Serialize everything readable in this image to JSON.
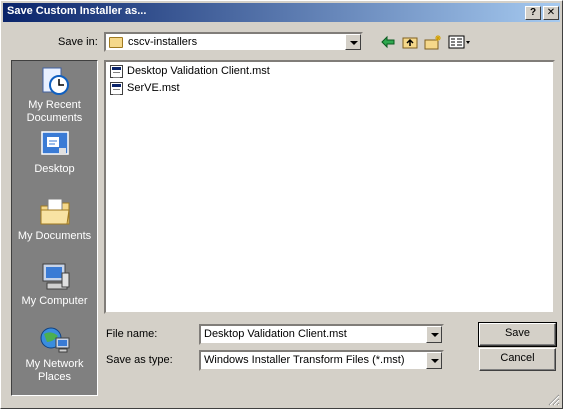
{
  "window": {
    "title": "Save Custom Installer as...",
    "help_glyph": "?",
    "close_glyph": "✕"
  },
  "save_in": {
    "label": "Save in:",
    "folder": "cscv-installers"
  },
  "toolbar": {
    "icons": [
      "back-icon",
      "up-folder-icon",
      "new-folder-icon",
      "views-menu-icon"
    ]
  },
  "places": [
    {
      "label": "My Recent Documents",
      "icon": "recent-documents-icon"
    },
    {
      "label": "Desktop",
      "icon": "desktop-icon"
    },
    {
      "label": "My Documents",
      "icon": "my-documents-icon"
    },
    {
      "label": "My Computer",
      "icon": "my-computer-icon"
    },
    {
      "label": "My Network Places",
      "icon": "network-places-icon"
    }
  ],
  "files": [
    {
      "name": "Desktop Validation Client.mst"
    },
    {
      "name": "SerVE.mst"
    }
  ],
  "file_name": {
    "label": "File name:",
    "value": "Desktop Validation Client.mst"
  },
  "save_as_type": {
    "label": "Save as type:",
    "value": "Windows Installer Transform Files (*.mst)"
  },
  "buttons": {
    "save": "Save",
    "cancel": "Cancel"
  },
  "colors": {
    "title_gradient_start": "#0a246a",
    "title_gradient_end": "#a6caf0",
    "dialog_face": "#d4d0c8",
    "places_bar": "#808080"
  }
}
